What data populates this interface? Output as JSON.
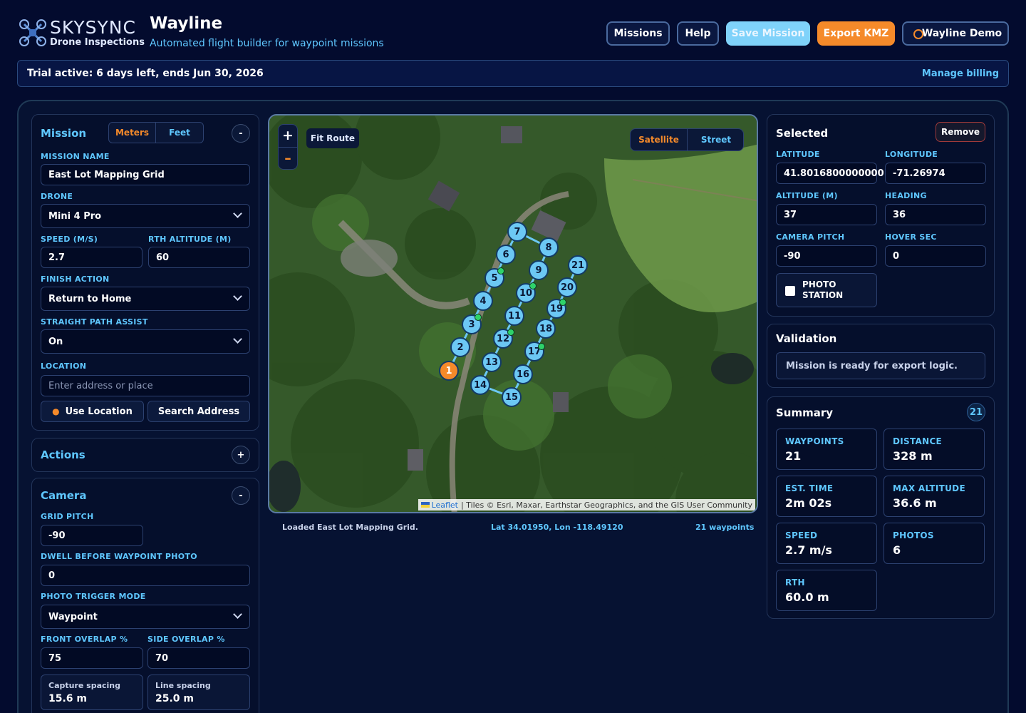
{
  "brand": {
    "name": "SKYSYNC",
    "subtitle": "Drone Inspections"
  },
  "app": {
    "title": "Wayline",
    "subtitle": "Automated flight builder for waypoint missions"
  },
  "header_buttons": {
    "missions": "Missions",
    "help": "Help",
    "save": "Save Mission",
    "export": "Export KMZ",
    "account": "Wayline Demo"
  },
  "trial": {
    "text": "Trial active: 6 days left, ends Jun 30, 2026",
    "link": "Manage billing"
  },
  "mission": {
    "title": "Mission",
    "units": [
      "Meters",
      "Feet"
    ],
    "name_label": "MISSION NAME",
    "name": "East Lot Mapping Grid",
    "drone_label": "DRONE",
    "drone": "Mini 4 Pro",
    "speed_label": "SPEED (M/S)",
    "speed": "2.7",
    "rth_label": "RTH ALTITUDE (M)",
    "rth": "60",
    "finish_label": "FINISH ACTION",
    "finish": "Return to Home",
    "assist_label": "STRAIGHT PATH ASSIST",
    "assist": "On",
    "location_label": "LOCATION",
    "location_placeholder": "Enter address or place",
    "use_location": "Use Location",
    "search_address": "Search Address",
    "collapse": "-"
  },
  "actions": {
    "title": "Actions",
    "expand": "+"
  },
  "camera": {
    "title": "Camera",
    "collapse": "-",
    "grid_pitch_label": "GRID PITCH",
    "grid_pitch": "-90",
    "dwell_label": "DWELL BEFORE WAYPOINT PHOTO",
    "dwell": "0",
    "trigger_label": "PHOTO TRIGGER MODE",
    "trigger": "Waypoint",
    "front_label": "FRONT OVERLAP %",
    "front": "75",
    "side_label": "SIDE OVERLAP %",
    "side": "70",
    "capture_label": "Capture spacing",
    "capture": "15.6 m",
    "line_label": "Line spacing",
    "line": "25.0 m"
  },
  "map": {
    "zoom_in": "+",
    "zoom_out": "–",
    "fit": "Fit Route",
    "layers": [
      "Satellite",
      "Street"
    ],
    "attribution_link": "Leaflet",
    "attribution_text": "| Tiles © Esri, Maxar, Earthstar Geographics, and the GIS User Community",
    "status": "Loaded East Lot Mapping Grid.",
    "coords": "Lat 34.01950, Lon -118.49120",
    "count": "21 waypoints",
    "waypoints": [
      "1",
      "2",
      "3",
      "4",
      "5",
      "6",
      "7",
      "8",
      "9",
      "10",
      "11",
      "12",
      "13",
      "14",
      "15",
      "16",
      "17",
      "18",
      "19",
      "20",
      "21"
    ]
  },
  "selected": {
    "title": "Selected",
    "remove": "Remove",
    "lat_label": "LATITUDE",
    "lat": "41.8016800000000",
    "lon_label": "LONGITUDE",
    "lon": "-71.26974",
    "alt_label": "ALTITUDE (M)",
    "alt": "37",
    "heading_label": "HEADING",
    "heading": "36",
    "pitch_label": "CAMERA PITCH",
    "pitch": "-90",
    "hover_label": "HOVER SEC",
    "hover": "0",
    "photo_station": "PHOTO STATION"
  },
  "validation": {
    "title": "Validation",
    "message": "Mission is ready for export logic."
  },
  "summary": {
    "title": "Summary",
    "badge": "21",
    "waypoints_label": "WAYPOINTS",
    "waypoints": "21",
    "distance_label": "DISTANCE",
    "distance": "328 m",
    "time_label": "EST. TIME",
    "time": "2m 02s",
    "maxalt_label": "MAX ALTITUDE",
    "maxalt": "36.6 m",
    "speed_label": "SPEED",
    "speed": "2.7 m/s",
    "photos_label": "PHOTOS",
    "photos": "6",
    "rth_label": "RTH",
    "rth": "60.0 m"
  },
  "colors": {
    "accent": "#5fc7ff",
    "orange": "#f58a2a",
    "bg": "#030b2e",
    "waypoint": "#6cc8f4"
  }
}
